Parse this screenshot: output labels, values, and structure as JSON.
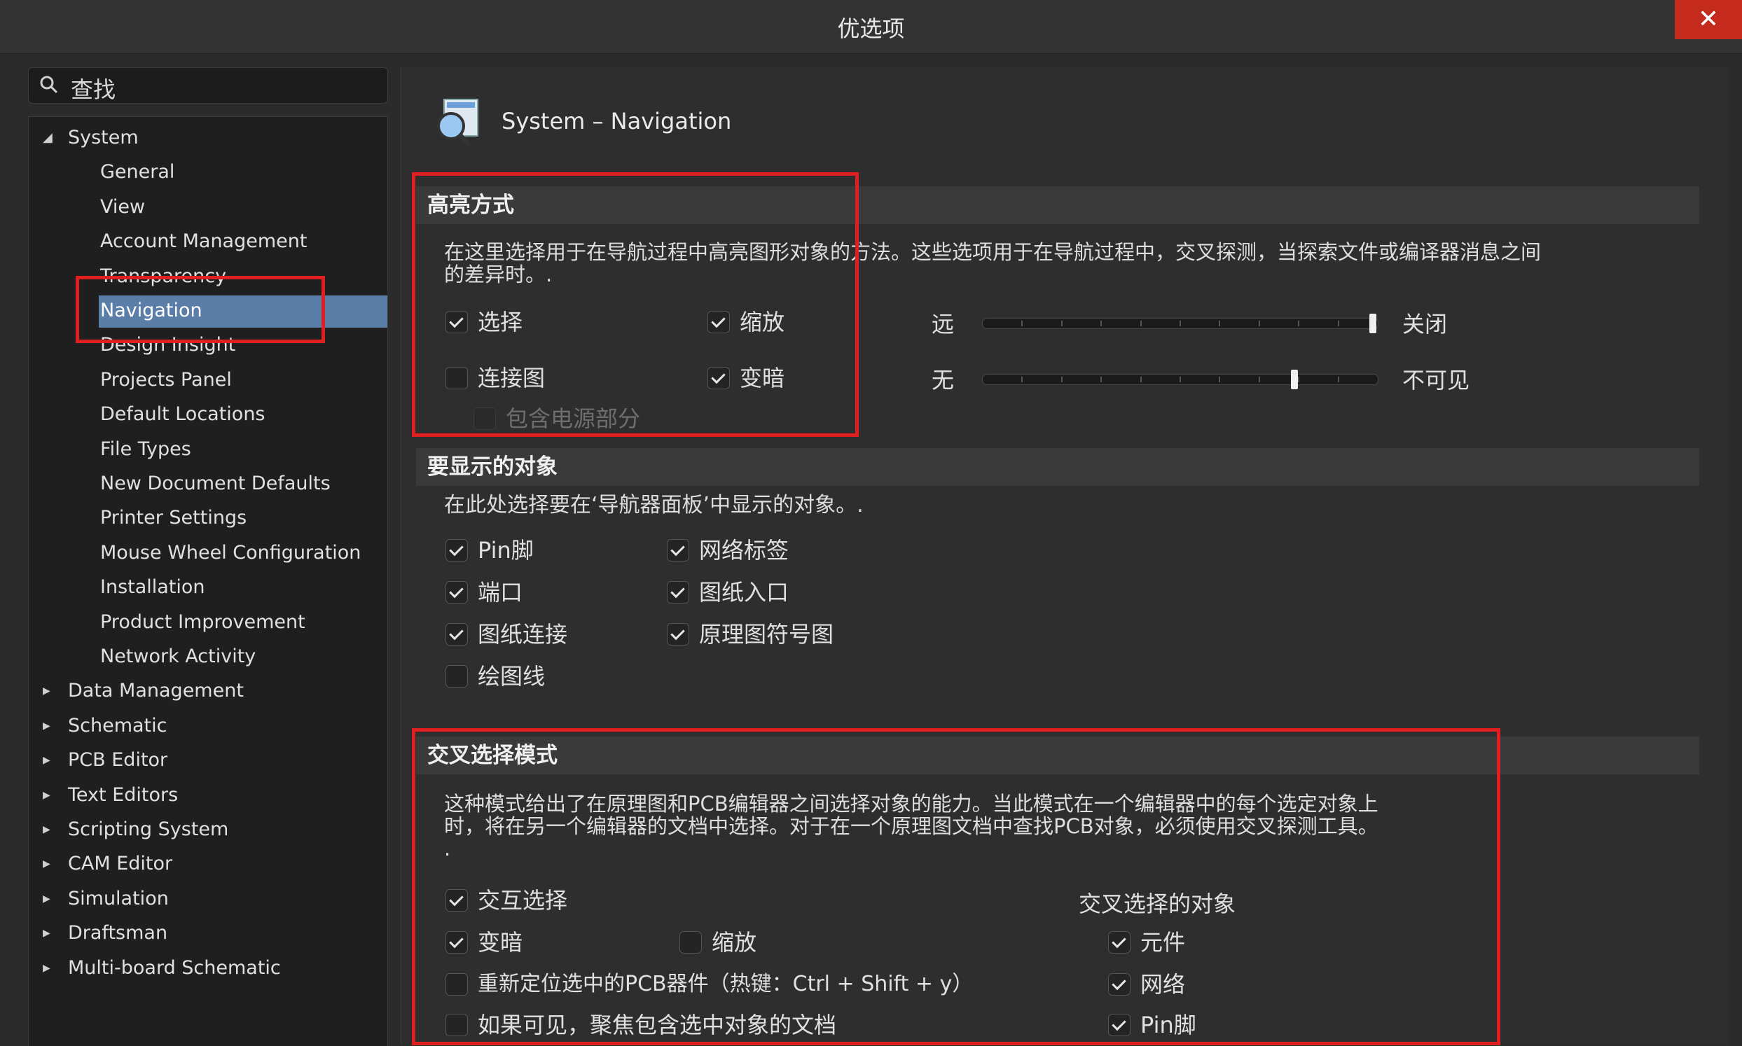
{
  "window": {
    "title": "优选项",
    "close_glyph": "✕"
  },
  "search": {
    "placeholder": "查找",
    "icon": "search-icon"
  },
  "tree": {
    "items": [
      {
        "label": "System",
        "level": 0,
        "expanded": true
      },
      {
        "label": "General",
        "level": 1
      },
      {
        "label": "View",
        "level": 1
      },
      {
        "label": "Account Management",
        "level": 1
      },
      {
        "label": "Transparency",
        "level": 1
      },
      {
        "label": "Navigation",
        "level": 1,
        "selected": true
      },
      {
        "label": "Design Insight",
        "level": 1
      },
      {
        "label": "Projects Panel",
        "level": 1
      },
      {
        "label": "Default Locations",
        "level": 1
      },
      {
        "label": "File Types",
        "level": 1
      },
      {
        "label": "New Document Defaults",
        "level": 1
      },
      {
        "label": "Printer Settings",
        "level": 1
      },
      {
        "label": "Mouse Wheel Configuration",
        "level": 1
      },
      {
        "label": "Installation",
        "level": 1
      },
      {
        "label": "Product Improvement",
        "level": 1
      },
      {
        "label": "Network Activity",
        "level": 1
      },
      {
        "label": "Data Management",
        "level": 0,
        "expanded": false
      },
      {
        "label": "Schematic",
        "level": 0,
        "expanded": false
      },
      {
        "label": "PCB Editor",
        "level": 0,
        "expanded": false
      },
      {
        "label": "Text Editors",
        "level": 0,
        "expanded": false
      },
      {
        "label": "Scripting System",
        "level": 0,
        "expanded": false
      },
      {
        "label": "CAM Editor",
        "level": 0,
        "expanded": false
      },
      {
        "label": "Simulation",
        "level": 0,
        "expanded": false
      },
      {
        "label": "Draftsman",
        "level": 0,
        "expanded": false
      },
      {
        "label": "Multi-board Schematic",
        "level": 0,
        "expanded": false
      }
    ]
  },
  "page": {
    "title": "System – Navigation",
    "icon": "navigation-magnifier-icon"
  },
  "highlight": {
    "heading": "高亮方式",
    "description_line1": "在这里选择用于在导航过程中高亮图形对象的方法。这些选项用于在导航过程中，交叉探测，当探索文件或编译器消息之间",
    "description_line2": "的差异时。.",
    "select": {
      "label": "选择",
      "checked": true
    },
    "zoom": {
      "label": "缩放",
      "checked": true
    },
    "connection_graph": {
      "label": "连接图",
      "checked": false
    },
    "dim": {
      "label": "变暗",
      "checked": true
    },
    "include_power": {
      "label": "包含电源部分",
      "checked": false,
      "disabled": true
    },
    "zoom_slider": {
      "min_label": "远",
      "max_label": "关闭",
      "value_fraction": 0.99
    },
    "dim_slider": {
      "min_label": "无",
      "max_label": "不可见",
      "value_fraction": 0.79
    }
  },
  "objects": {
    "heading": "要显示的对象",
    "description": "在此处选择要在‘导航器面板’中显示的对象。.",
    "items": [
      {
        "label": "Pin脚",
        "checked": true
      },
      {
        "label": "网络标签",
        "checked": true
      },
      {
        "label": "端口",
        "checked": true
      },
      {
        "label": "图纸入口",
        "checked": true
      },
      {
        "label": "图纸连接",
        "checked": true
      },
      {
        "label": "原理图符号图",
        "checked": true
      },
      {
        "label": "绘图线",
        "checked": false
      }
    ]
  },
  "cross_select": {
    "heading": "交叉选择模式",
    "description_line1": "这种模式给出了在原理图和PCB编辑器之间选择对象的能力。当此模式在一个编辑器中的每个选定对象上",
    "description_line2": "时，将在另一个编辑器的文档中选择。对于在一个原理图文档中查找PCB对象，必须使用交叉探测工具。",
    "description_line3": ".",
    "interactive_select": {
      "label": "交互选择",
      "checked": true
    },
    "dim": {
      "label": "变暗",
      "checked": true
    },
    "zoom": {
      "label": "缩放",
      "checked": false
    },
    "reposition": {
      "label": "重新定位选中的PCB器件（热键：Ctrl + Shift + y）",
      "checked": false
    },
    "focus_doc": {
      "label": "如果可见，聚焦包含选中对象的文档",
      "checked": false
    },
    "objects_title": "交叉选择的对象",
    "components": {
      "label": "元件",
      "checked": true
    },
    "nets": {
      "label": "网络",
      "checked": true
    },
    "pins": {
      "label": "Pin脚",
      "checked": true
    }
  },
  "colors": {
    "annotation_red": "#e02020",
    "selection_blue": "#5b7ea8"
  }
}
